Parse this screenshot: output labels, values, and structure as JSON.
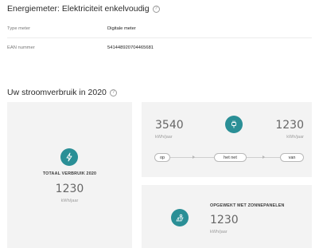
{
  "meter": {
    "title": "Energiemeter: Elektriciteit enkelvoudig",
    "rows": [
      {
        "label": "Type meter",
        "value": "Digitale meter"
      },
      {
        "label": "EAN nummer",
        "value": "541448920704465681"
      }
    ]
  },
  "usage": {
    "title": "Uw stroomverbruik in 2020",
    "total": {
      "label": "TOTAAL VERBRUIK 2020",
      "value": "1230",
      "unit": "kWh/jaar"
    },
    "grid": {
      "left_value": "3540",
      "left_unit": "kWh/jaar",
      "right_value": "1230",
      "right_unit": "kWh/jaar",
      "flow": {
        "left": "op",
        "middle": "het net",
        "right": "van"
      }
    },
    "solar": {
      "label": "OPGEWEKT MET ZONNEPANELEN",
      "value": "1230",
      "unit": "kWh/jaar"
    }
  },
  "icons": {
    "help": "help-circle-icon",
    "total": "lightning-icon",
    "grid": "plug-icon",
    "solar": "solar-panel-icon"
  },
  "colors": {
    "accent": "#2a8f96",
    "card": "#f3f3f3"
  }
}
